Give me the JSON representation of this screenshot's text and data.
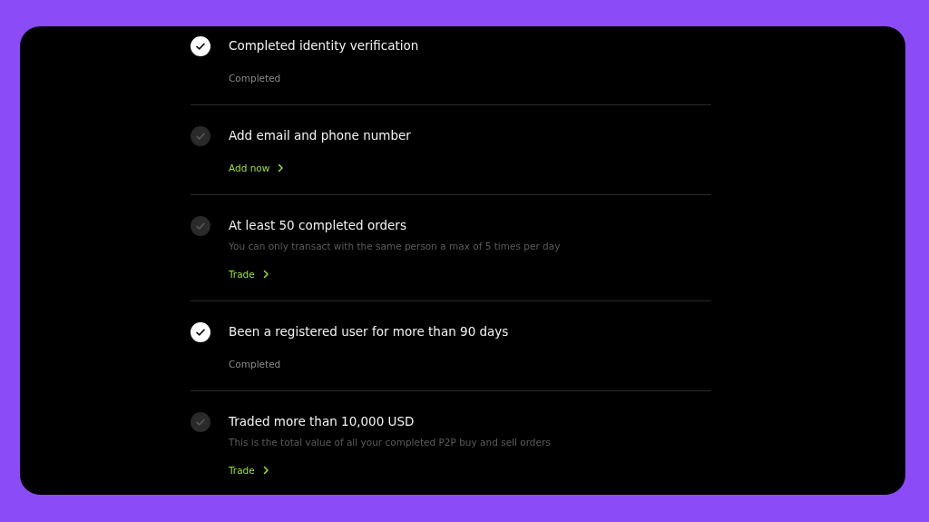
{
  "requirements": [
    {
      "title": "Completed identity verification",
      "done": true,
      "action": {
        "kind": "status",
        "label": "Completed"
      }
    },
    {
      "title": "Add email and phone number",
      "done": false,
      "action": {
        "kind": "link",
        "label": "Add now"
      }
    },
    {
      "title": "At least 50 completed orders",
      "done": false,
      "note": "You can only transact with the same person a max of 5 times per day",
      "action": {
        "kind": "link",
        "label": "Trade"
      }
    },
    {
      "title": "Been a registered user for more than 90 days",
      "done": true,
      "action": {
        "kind": "status",
        "label": "Completed"
      }
    },
    {
      "title": "Traded more than 10,000 USD",
      "done": false,
      "note": "This is the total value of all your completed P2P buy and sell orders",
      "action": {
        "kind": "link",
        "label": "Trade"
      }
    }
  ]
}
